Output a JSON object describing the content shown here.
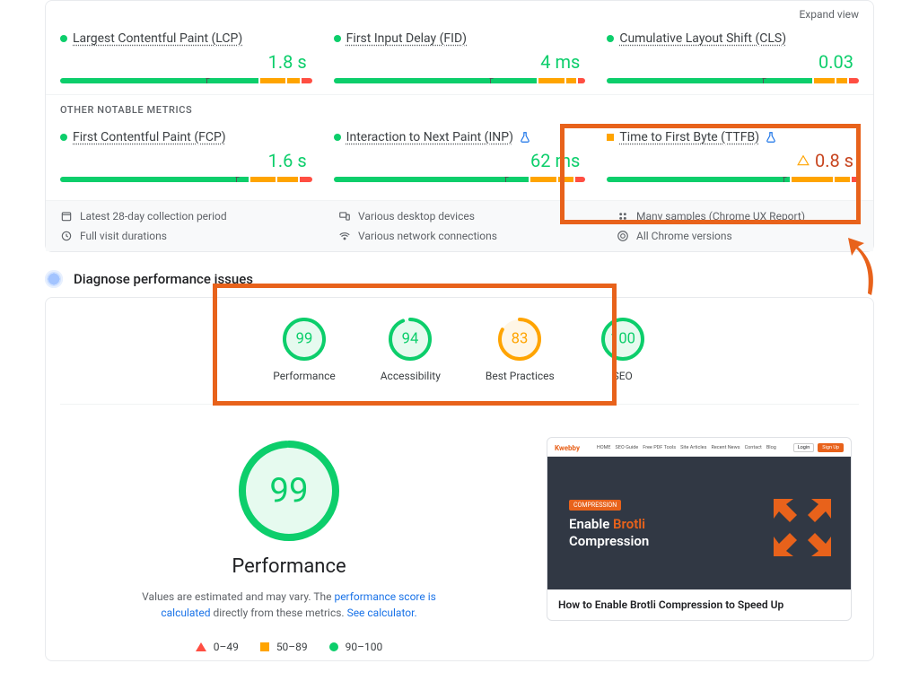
{
  "expand_label": "Expand view",
  "core_metrics": [
    {
      "name": "Largest Contentful Paint (LCP)",
      "value": "1.8 s",
      "status": "green",
      "marker_pct": 58,
      "segments": [
        78,
        10,
        5,
        4
      ]
    },
    {
      "name": "First Input Delay (FID)",
      "value": "4 ms",
      "status": "green",
      "marker_pct": 62,
      "segments": [
        80,
        10,
        4,
        3
      ]
    },
    {
      "name": "Cumulative Layout Shift (CLS)",
      "value": "0.03",
      "status": "green",
      "marker_pct": 62,
      "segments": [
        80,
        8,
        4,
        4
      ]
    }
  ],
  "other_header": "OTHER NOTABLE METRICS",
  "other_metrics": [
    {
      "name": "First Contentful Paint (FCP)",
      "value": "1.6 s",
      "status": "green",
      "experimental": false,
      "marker_pct": 70,
      "segments": [
        74,
        10,
        8,
        5
      ]
    },
    {
      "name": "Interaction to Next Paint (INP)",
      "value": "62 ms",
      "status": "green",
      "experimental": true,
      "marker_pct": 68,
      "segments": [
        76,
        10,
        6,
        4
      ]
    },
    {
      "name": "Time to First Byte (TTFB)",
      "value": "0.8 s",
      "status": "amber",
      "experimental": true,
      "marker_pct": 70,
      "segments": [
        72,
        16,
        6,
        3
      ]
    }
  ],
  "footer": {
    "period": "Latest 28-day collection period",
    "durations": "Full visit durations",
    "devices": "Various desktop devices",
    "network": "Various network connections",
    "samples_prefix": "Many samples (",
    "samples_link": "Chrome UX Report",
    "samples_suffix": ")",
    "versions": "All Chrome versions"
  },
  "diagnose_title": "Diagnose performance issues",
  "gauges": [
    {
      "label": "Performance",
      "score": 99,
      "color": "#0cce6b",
      "fill": "#e6faef"
    },
    {
      "label": "Accessibility",
      "score": 94,
      "color": "#0cce6b",
      "fill": "#e6faef"
    },
    {
      "label": "Best Practices",
      "score": 83,
      "color": "#ffa400",
      "fill": "#fff6e6"
    },
    {
      "label": "SEO",
      "score": 100,
      "color": "#0cce6b",
      "fill": "#e6faef"
    }
  ],
  "big_gauge": {
    "label": "Performance",
    "score": 99,
    "color": "#0cce6b",
    "fill": "#e6faef"
  },
  "perf_desc": {
    "prefix": "Values are estimated and may vary. The ",
    "link1": "performance score is calculated",
    "middle": " directly from these metrics. ",
    "link2": "See calculator.",
    "suffix": ""
  },
  "legend": {
    "bad": "0–49",
    "mid": "50–89",
    "good": "90–100"
  },
  "preview": {
    "logo": "Kwebby",
    "nav": [
      "HOME",
      "SEO Guide",
      "Free PDF Tools",
      "Site Articles",
      "Recent News",
      "Contact",
      "Blog"
    ],
    "login": "Login",
    "cta": "Sign Up",
    "tag": "COMPRESSION",
    "title_parts": {
      "white1": "Enable ",
      "orange1": "Brotli",
      "white2": "Compression"
    },
    "caption": "How to Enable Brotli Compression to Speed Up"
  }
}
